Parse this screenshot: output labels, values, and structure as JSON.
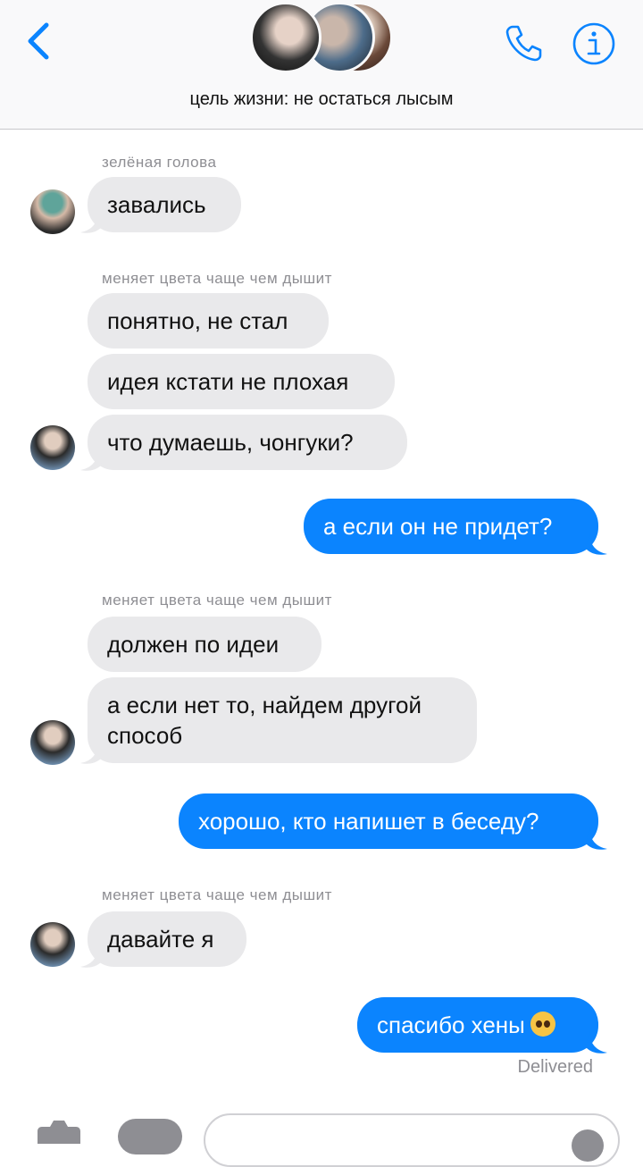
{
  "header": {
    "title": "цель жизни: не остаться лысым",
    "back_icon": "chevron-left-icon",
    "call_icon": "phone-icon",
    "info_icon": "info-icon"
  },
  "messages": [
    {
      "sender": "зелёная голова",
      "text": "завались"
    },
    {
      "sender": "меняет цвета чаще чем дышит",
      "texts": [
        "понятно, не стал",
        "идея кстати не плохая",
        "что думаешь, чонгуки?"
      ]
    },
    {
      "out": "а если он не придет?"
    },
    {
      "sender": "меняет цвета чаще чем дышит",
      "texts": [
        "должен по идеи",
        "а если нет то, найдем другой",
        "способ"
      ]
    },
    {
      "out": "хорошо, кто напишет в беседу?"
    },
    {
      "sender": "меняет цвета чаще чем дышит",
      "text": "давайте я"
    },
    {
      "out": "спасибо хены"
    }
  ],
  "status": {
    "delivered": "Delivered"
  },
  "colors": {
    "accent": "#0b84fe",
    "incoming": "#e9e9eb"
  }
}
